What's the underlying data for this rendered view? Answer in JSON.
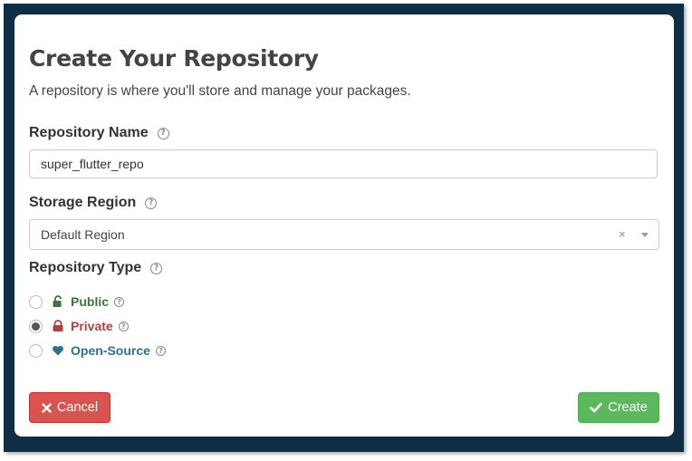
{
  "dialog": {
    "title": "Create Your Repository",
    "subtitle": "A repository is where you'll store and manage your packages."
  },
  "repo_name": {
    "label": "Repository Name",
    "value": "super_flutter_repo"
  },
  "storage_region": {
    "label": "Storage Region",
    "selected": "Default Region",
    "clear_glyph": "×"
  },
  "repo_type": {
    "label": "Repository Type",
    "options": [
      {
        "label": "Public",
        "icon": "unlock-icon",
        "color": "#3c763d",
        "checked": false
      },
      {
        "label": "Private",
        "icon": "lock-icon",
        "color": "#a94442",
        "checked": true
      },
      {
        "label": "Open-Source",
        "icon": "heart-icon",
        "color": "#31708f",
        "checked": false
      }
    ]
  },
  "help_glyph": "?",
  "buttons": {
    "cancel": "Cancel",
    "create": "Create"
  },
  "colors": {
    "frame": "#0f2e45",
    "cancel": "#d9534f",
    "create": "#5cb85c"
  }
}
